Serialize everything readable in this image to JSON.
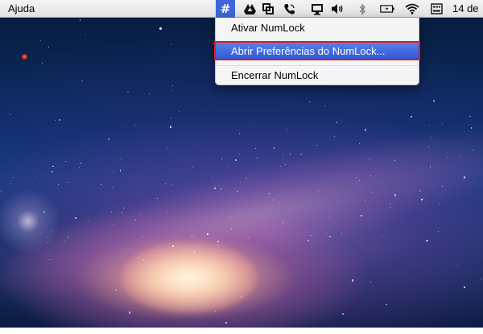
{
  "menubar": {
    "app_menu_label": "Ajuda",
    "clock_text": "14 de",
    "numlock_symbol": "#",
    "status_icons": [
      "numlock-icon",
      "google-drive-icon",
      "screen-capture-icon",
      "phone-icon",
      "display-icon",
      "volume-icon",
      "bluetooth-icon",
      "battery-icon",
      "wifi-icon",
      "keyboard-input-icon"
    ]
  },
  "dropdown": {
    "items": [
      {
        "label": "Ativar NumLock"
      },
      {
        "label": "Abrir Preferências do NumLock..."
      },
      {
        "label": "Encerrar NumLock"
      }
    ],
    "highlighted_index": 1
  },
  "colors": {
    "highlight": "#2a56d8",
    "annotation_outline": "#e21a1a",
    "numlock_icon_bg": "#3d66d9"
  }
}
